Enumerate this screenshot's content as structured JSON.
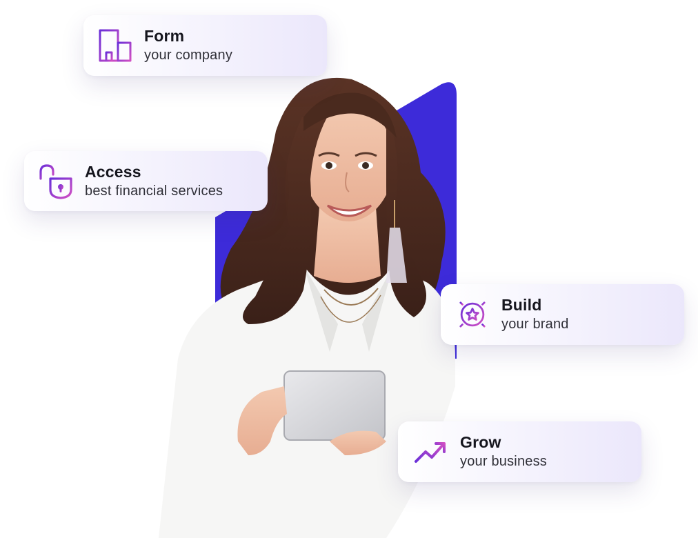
{
  "colors": {
    "accent_blue": "#3d2bd9",
    "icon_gradient_start": "#6a2fd8",
    "icon_gradient_end": "#d24fc3",
    "title_text": "#16161e",
    "subtitle_text": "#303038"
  },
  "hero_image": {
    "subject": "smiling woman holding tablet"
  },
  "cards": [
    {
      "icon": "building-icon",
      "title": "Form",
      "subtitle": "your company"
    },
    {
      "icon": "unlocked-padlock-icon",
      "title": "Access",
      "subtitle": "best financial services"
    },
    {
      "icon": "star-badge-icon",
      "title": "Build",
      "subtitle": "your brand"
    },
    {
      "icon": "trending-up-icon",
      "title": "Grow",
      "subtitle": "your business"
    }
  ]
}
